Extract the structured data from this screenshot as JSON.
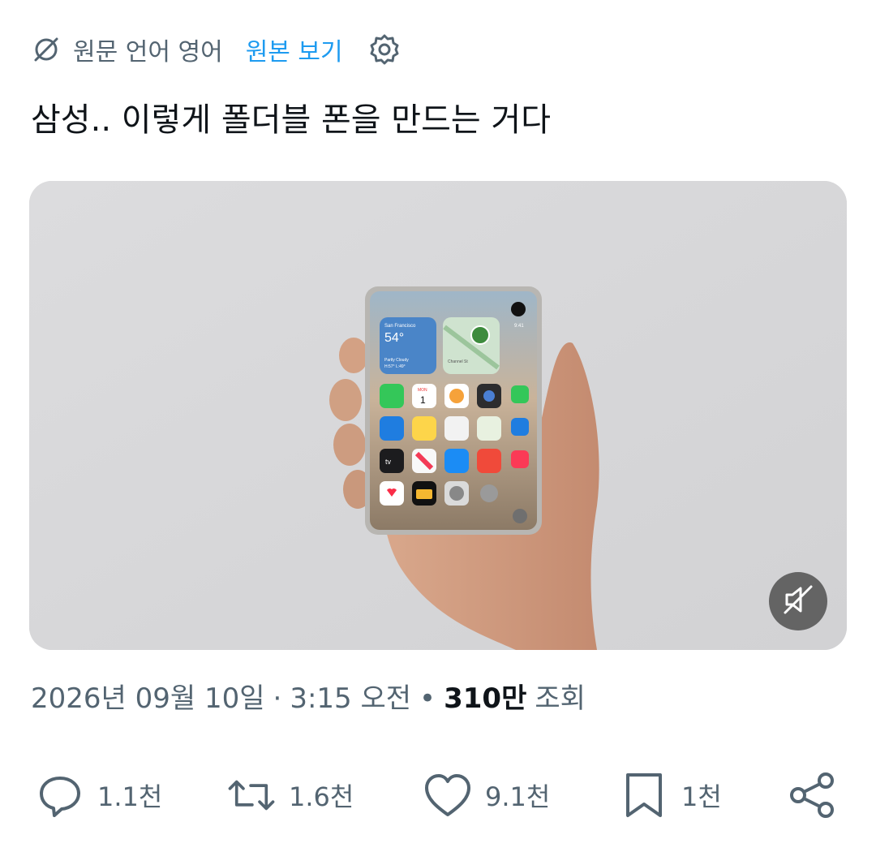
{
  "translation": {
    "source_language_label": "원문 언어 영어",
    "show_original_label": "원본 보기"
  },
  "tweet": {
    "text": "삼성.. 이렇게 폴더블 폰을 만드는 거다"
  },
  "media": {
    "phone_screen": {
      "weather_city": "San Francisco",
      "weather_temp": "54°",
      "weather_condition": "Partly Cloudy",
      "weather_range": "H:57° L:49°",
      "map_label": "Channel St",
      "calendar_day": "MON",
      "calendar_date": "1",
      "tv_label": "tv",
      "time": "9:41"
    },
    "mute_icon": "speaker-muted-icon"
  },
  "meta": {
    "date": "2026년 09월 10일",
    "separator": "·",
    "time": "3:15 오전",
    "views_count": "310만",
    "views_label": "조회"
  },
  "actions": {
    "reply_count": "1.1천",
    "retweet_count": "1.6천",
    "like_count": "9.1천",
    "bookmark_count": "1천",
    "icons": [
      "reply-icon",
      "retweet-icon",
      "heart-icon",
      "bookmark-icon",
      "share-icon"
    ]
  },
  "colors": {
    "link": "#1d9bf0",
    "muted_text": "#536471",
    "primary_text": "#0f1419"
  }
}
